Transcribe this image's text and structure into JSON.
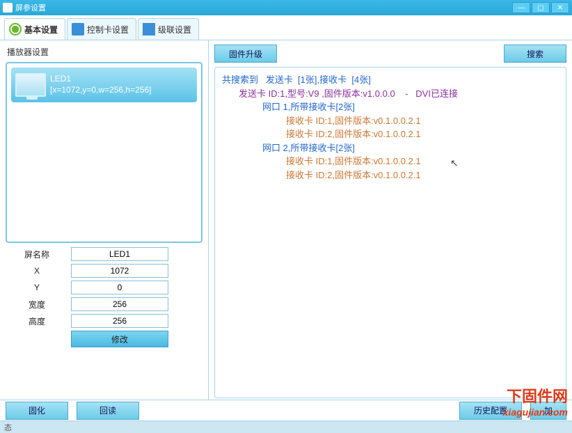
{
  "window": {
    "title": "屏参设置",
    "min": "—",
    "max": "▢",
    "close": "✕"
  },
  "tabs": {
    "basic": "基本设置",
    "controller": "控制卡设置",
    "cascade": "级联设置"
  },
  "sidebar": {
    "section": "播放器设置",
    "screen": {
      "name": "LED1",
      "coords": "[x=1072,y=0,w=256,h=256]"
    },
    "labels": {
      "screen_name": "屏名称",
      "x": "X",
      "y": "Y",
      "width": "宽度",
      "height": "高度"
    },
    "values": {
      "screen_name": "LED1",
      "x": "1072",
      "y": "0",
      "width": "256",
      "height": "256"
    },
    "modify": "修改"
  },
  "right": {
    "upgrade": "固件升级",
    "search": "搜索",
    "tree": {
      "summary_a": "共搜索到   发送卡  [1张],接收卡  [4张]",
      "sender": "发送卡 ID:1,型号:V9 ,固件版本:v1.0.0.0    -   DVI已连接",
      "port1": "网口 1,所带接收卡[2张]",
      "p1r1": "接收卡 ID:1,固件版本:v0.1.0.0.2.1",
      "p1r2": "接收卡 ID:2,固件版本:v0.1.0.0.2.1",
      "port2": "网口 2,所带接收卡[2张]",
      "p2r1": "接收卡 ID:1,固件版本:v0.1.0.0.2.1",
      "p2r2": "接收卡 ID:2,固件版本:v0.1.0.0.2.1"
    }
  },
  "bottom": {
    "solidify": "固化",
    "readback": "回读",
    "history": "历史配置",
    "add": "加"
  },
  "status": "态",
  "watermark": {
    "cn": "下固件网",
    "en": "xiagujian.com"
  }
}
